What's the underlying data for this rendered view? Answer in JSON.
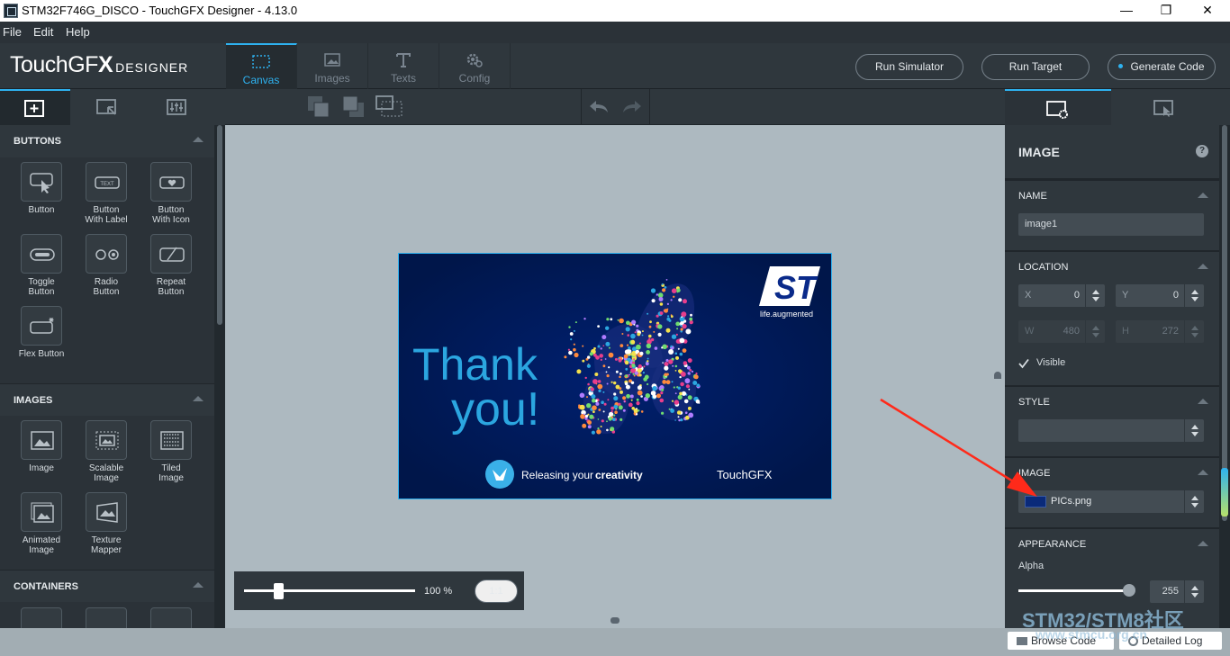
{
  "window": {
    "title": "STM32F746G_DISCO - TouchGFX Designer - 4.13.0",
    "minimize": "—",
    "restore": "❐",
    "close": "✕"
  },
  "menu": {
    "file": "File",
    "edit": "Edit",
    "help": "Help"
  },
  "logo": {
    "brand": "TouchGF",
    "brand_x": "X",
    "sub": "DESIGNER"
  },
  "nav_tabs": [
    {
      "label": "Canvas"
    },
    {
      "label": "Images"
    },
    {
      "label": "Texts"
    },
    {
      "label": "Config"
    }
  ],
  "actions": {
    "run_simulator": "Run Simulator",
    "run_target": "Run Target",
    "generate_code": "Generate Code"
  },
  "widgets": {
    "buttons": {
      "header": "BUTTONS",
      "items": [
        {
          "label1": "Button",
          "label2": ""
        },
        {
          "label1": "Button",
          "label2": "With Label"
        },
        {
          "label1": "Button",
          "label2": "With Icon"
        },
        {
          "label1": "Toggle",
          "label2": "Button"
        },
        {
          "label1": "Radio",
          "label2": "Button"
        },
        {
          "label1": "Repeat",
          "label2": "Button"
        },
        {
          "label1": "Flex Button",
          "label2": ""
        }
      ]
    },
    "images": {
      "header": "IMAGES",
      "items": [
        {
          "label1": "Image",
          "label2": ""
        },
        {
          "label1": "Scalable",
          "label2": "Image"
        },
        {
          "label1": "Tiled",
          "label2": "Image"
        },
        {
          "label1": "Animated",
          "label2": "Image"
        },
        {
          "label1": "Texture",
          "label2": "Mapper"
        }
      ]
    },
    "containers": {
      "header": "CONTAINERS"
    }
  },
  "screen_image": {
    "thank": "Thank",
    "you": "you!",
    "st_tagline": "life.augmented",
    "releasing": "Releasing your",
    "creativity": "creativity",
    "touchgfx": "TouchGFX"
  },
  "zoom": {
    "value": "100 %",
    "reset": "1:1",
    "level": 0.2
  },
  "properties": {
    "title": "IMAGE",
    "help": "?",
    "name_header": "NAME",
    "name_value": "image1",
    "location_header": "LOCATION",
    "x_label": "X",
    "x_value": "0",
    "y_label": "Y",
    "y_value": "0",
    "w_label": "W",
    "w_value": "480",
    "h_label": "H",
    "h_value": "272",
    "visible_label": "Visible",
    "style_header": "STYLE",
    "image_header": "IMAGE",
    "image_value": "PICs.png",
    "appearance_header": "APPEARANCE",
    "alpha_label": "Alpha",
    "alpha_value": "255"
  },
  "statusbar": {
    "browse_code": "Browse Code",
    "detailed_log": "Detailed Log"
  },
  "watermark": {
    "line1": "STM32/STM8社区",
    "line2": "www.stmcu.org.cn"
  },
  "colors": {
    "accent": "#2eb2f0",
    "panel": "#2b3238",
    "canvas": "#adb9c0",
    "screen_bg": "#001a55",
    "arrow": "#ff2a1a"
  }
}
